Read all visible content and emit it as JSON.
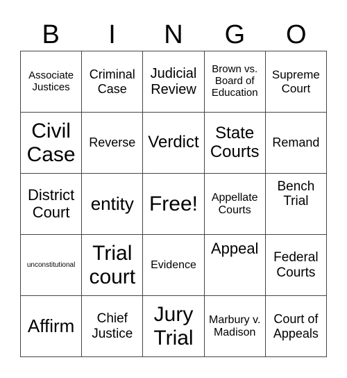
{
  "header": {
    "letters": [
      "B",
      "I",
      "N",
      "G",
      "O"
    ]
  },
  "cells": [
    "Associate Justices",
    "Criminal Case",
    "Judicial Review",
    "Brown vs. Board of Education",
    "Supreme Court",
    "Civil Case",
    "Reverse",
    "Verdict",
    "State Courts",
    "Remand",
    "District Court",
    "entity",
    "Free!",
    "Appellate Courts",
    "Bench Trial",
    "unconstitutional",
    "Trial court",
    "Evidence",
    "Appeal",
    "Federal Courts",
    "Affirm",
    "Chief Justice",
    "Jury Trial",
    "Marbury v. Madison",
    "Court of Appeals"
  ]
}
